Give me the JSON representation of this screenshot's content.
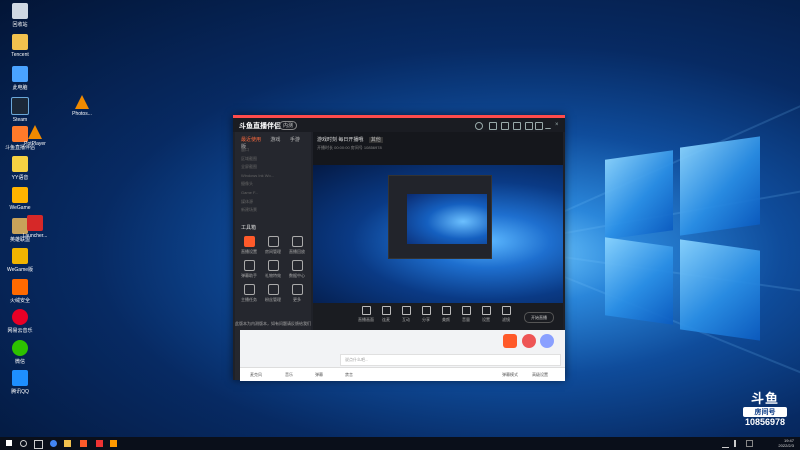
{
  "desktop": {
    "icons": [
      {
        "label": "回收站",
        "icon": "recycle-bin-icon"
      },
      {
        "label": "Tencent",
        "icon": "file-icon"
      },
      {
        "label": "此电脑",
        "icon": "computer-icon"
      },
      {
        "label": "Steam",
        "icon": "steam-icon"
      },
      {
        "label": "斗鱼直播伴侣",
        "icon": "douyu-icon"
      },
      {
        "label": "YY语音",
        "icon": "yy-icon"
      },
      {
        "label": "WeGame",
        "icon": "wegame-icon"
      },
      {
        "label": "英雄联盟",
        "icon": "lol-icon"
      },
      {
        "label": "WeGame版",
        "icon": "wegame-icon"
      },
      {
        "label": "火绒安全",
        "icon": "huorong-icon"
      },
      {
        "label": "网易云音乐",
        "icon": "netease-icon"
      },
      {
        "label": "微信",
        "icon": "wechat-icon"
      },
      {
        "label": "腾讯QQ",
        "icon": "qq-icon"
      },
      {
        "label": "PotPlayer",
        "icon": "vlc-icon"
      },
      {
        "label": "Photos...",
        "icon": "vlc-icon"
      },
      {
        "label": "Launcher...",
        "icon": "launcher-icon"
      }
    ]
  },
  "app": {
    "logo": "斗鱼直播伴侣",
    "badge": "内测",
    "sidebar_tabs": [
      "最近使用",
      "游戏",
      "手游版"
    ],
    "recent_items": [
      "窗口",
      "区域截图",
      "全屏截图",
      "Windows Ink Wo...",
      "摄像头",
      "Game F...",
      "媒体源",
      "新建场景"
    ],
    "toolbox_title": "工具箱",
    "tools": [
      "直播设置",
      "房间管理",
      "直播回放",
      "弹幕助手",
      "礼物特效",
      "数据中心",
      "主播任务",
      "粉丝管理",
      "更多"
    ],
    "room_title": "游戏时刻 每日开播哦",
    "room_tag": "其他",
    "room_meta": "开播时长 00:00:00    房间号 10856978",
    "controls": [
      "直播画面",
      "连麦",
      "互动",
      "分享",
      "美颜",
      "音量",
      "设置",
      "滤镜"
    ],
    "start_live": "开始直播",
    "notice": "此版本为内测版本，如有问题请反馈给我们"
  },
  "chat": {
    "placeholder": "说点什么吧...",
    "bottom_items": [
      "麦克风",
      "音乐",
      "弹幕",
      "禁言",
      "高级设置"
    ],
    "mode": "弹幕模式"
  },
  "watermark": {
    "brand": "斗鱼",
    "room_label": "房间号",
    "room_number": "10856978"
  },
  "taskbar": {
    "time": "19:47",
    "date": "2022/2/3"
  }
}
